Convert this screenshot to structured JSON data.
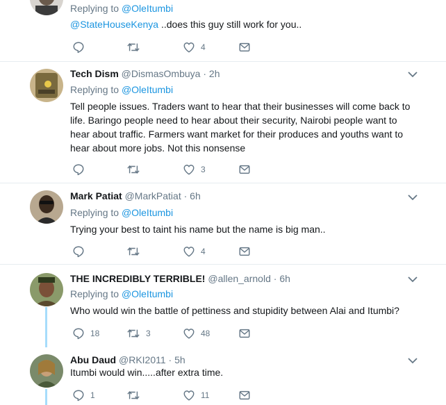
{
  "tweets": [
    {
      "replying_prefix": "Replying to ",
      "replying_to": "@OleItumbi",
      "mention": "@StateHouseKenya",
      "text": " ..does this guy still work for you..",
      "reply_count": "",
      "retweet_count": "",
      "like_count": "4"
    },
    {
      "name": "Tech Dism",
      "handle": "@DismasOmbuya",
      "sep": "·",
      "time": "2h",
      "replying_prefix": "Replying to ",
      "replying_to": "@OleItumbi",
      "text": "Tell people issues. Traders want to hear that their businesses will come back to life. Baringo people need to hear about their security, Nairobi people want to hear about traffic. Farmers want market for their produces and youths want to hear about more jobs. Not this nonsense",
      "reply_count": "",
      "retweet_count": "",
      "like_count": "3"
    },
    {
      "name": "Mark Patiat",
      "handle": "@MarkPatiat",
      "sep": "·",
      "time": "6h",
      "replying_prefix": "Replying to ",
      "replying_to": "@OleItumbi",
      "text": "Trying your best to taint his name but the name is big man..",
      "reply_count": "",
      "retweet_count": "",
      "like_count": "4"
    },
    {
      "name": "THE INCREDIBLY TERRIBLE!",
      "handle": "@allen_arnold",
      "sep": "·",
      "time": "6h",
      "replying_prefix": "Replying to ",
      "replying_to": "@OleItumbi",
      "text": "Who would win the battle of pettiness and stupidity between Alai and Itumbi?",
      "reply_count": "18",
      "retweet_count": "3",
      "like_count": "48"
    },
    {
      "name": "Abu Daud",
      "handle": "@RKI2011",
      "sep": "·",
      "time": "5h",
      "text": "Itumbi would win.....after extra time.",
      "reply_count": "1",
      "retweet_count": "",
      "like_count": "11"
    }
  ],
  "colors": {
    "link": "#1b95e0",
    "muted": "#657786",
    "thread": "#a6dcfb",
    "divider": "#e6ecf0"
  },
  "icons": [
    "reply-icon",
    "retweet-icon",
    "like-icon",
    "dm-icon",
    "chevron-down-icon"
  ]
}
